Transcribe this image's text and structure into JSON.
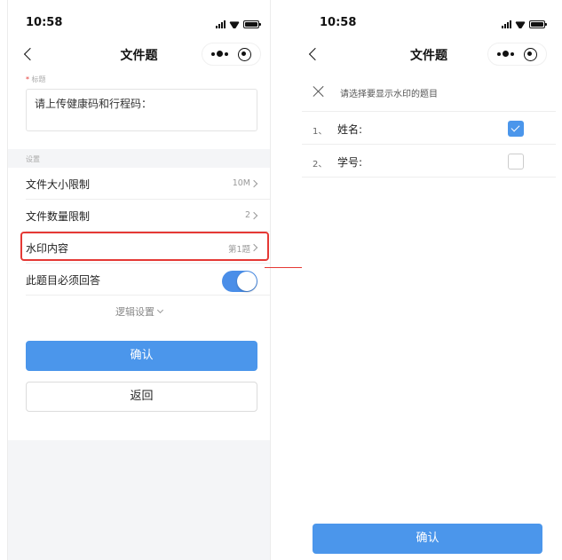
{
  "left_screen": {
    "status_time": "10:58",
    "nav_title": "文件题",
    "field_label": "标题",
    "field_required_mark": "*",
    "title_value": "请上传健康码和行程码：",
    "section_label": "设置",
    "rows": [
      {
        "label": "文件大小限制",
        "value": "10M"
      },
      {
        "label": "文件数量限制",
        "value": "2"
      },
      {
        "label": "水印内容",
        "value": "第1题"
      }
    ],
    "required_toggle": {
      "label": "此题目必须回答",
      "on": true
    },
    "logic_label": "逻辑设置",
    "confirm_label": "确认",
    "back_label": "返回"
  },
  "right_screen": {
    "status_time": "10:58",
    "nav_title": "文件题",
    "sheet_title": "请选择要显示水印的题目",
    "options": [
      {
        "num": "1、",
        "label": "姓名:",
        "checked": true
      },
      {
        "num": "2、",
        "label": "学号:",
        "checked": false
      }
    ],
    "confirm_label": "确认"
  },
  "colors": {
    "accent": "#4b96eb",
    "highlight": "#e53935",
    "page_gray": "#f4f5f7"
  }
}
